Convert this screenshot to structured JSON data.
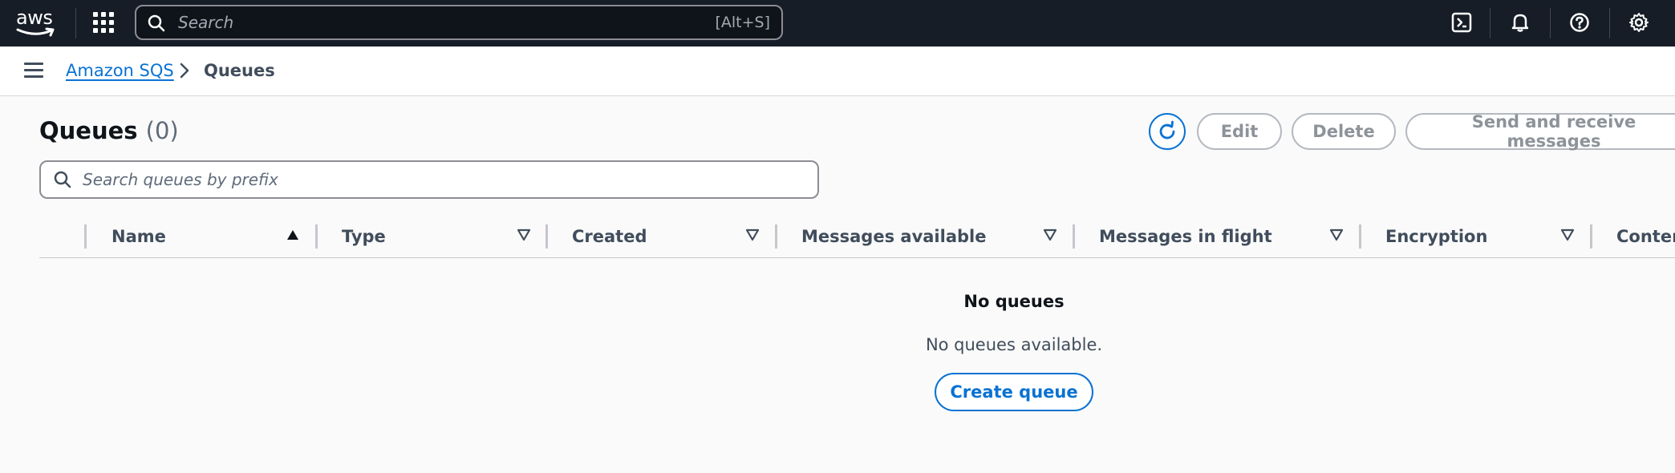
{
  "topnav": {
    "logo_text": "aws",
    "search_placeholder": "Search",
    "search_shortcut": "[Alt+S]",
    "icons": [
      "cloudshell-icon",
      "bell-icon",
      "help-icon",
      "gear-icon"
    ]
  },
  "breadcrumb": {
    "service": "Amazon SQS",
    "current": "Queues"
  },
  "header": {
    "title": "Queues",
    "count": "(0)"
  },
  "actions": {
    "edit": "Edit",
    "delete": "Delete",
    "send_receive": "Send and receive messages"
  },
  "queue_search": {
    "placeholder": "Search queues by prefix"
  },
  "table": {
    "columns": [
      {
        "label": "Name",
        "sort": "ascending"
      },
      {
        "label": "Type",
        "sort": "none"
      },
      {
        "label": "Created",
        "sort": "none"
      },
      {
        "label": "Messages available",
        "sort": "none"
      },
      {
        "label": "Messages in flight",
        "sort": "none"
      },
      {
        "label": "Encryption",
        "sort": "none"
      },
      {
        "label": "Content",
        "sort": "none"
      }
    ]
  },
  "empty_state": {
    "title": "No queues",
    "description": "No queues available.",
    "create_button": "Create queue"
  },
  "colors": {
    "nav_bg": "#161d26",
    "accent": "#0972d3",
    "disabled": "#8d9399"
  }
}
